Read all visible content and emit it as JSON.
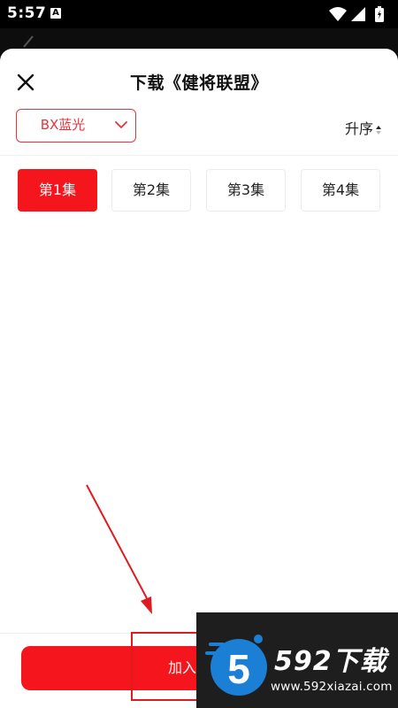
{
  "status_bar": {
    "time": "5:57",
    "notification_badge": "A"
  },
  "sheet": {
    "title": "下载《健将联盟》",
    "quality": {
      "selected": "BX蓝光"
    },
    "sort": {
      "label": "升序"
    },
    "episodes": [
      {
        "label": "第1集",
        "active": true
      },
      {
        "label": "第2集",
        "active": false
      },
      {
        "label": "第3集",
        "active": false
      },
      {
        "label": "第4集",
        "active": false
      }
    ],
    "add_button_label": "加入"
  },
  "watermark": {
    "logo_digit": "5",
    "name": "592下载",
    "url": "www.592xiazai.com"
  },
  "colors": {
    "accent": "#f5161d",
    "select_border": "#e8333a",
    "watermark_bg": "#1e1e1e"
  }
}
